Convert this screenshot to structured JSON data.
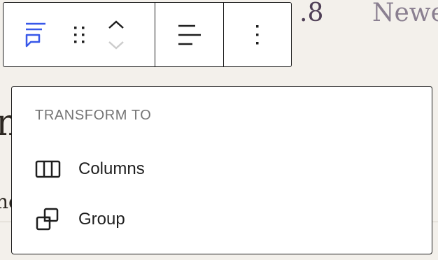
{
  "background": {
    "heading_fragment": ".8",
    "nav_fragment": "Newe",
    "title_fragment": "n",
    "body_fragment": "ne"
  },
  "toolbar": {
    "block_icon": "quote-block-icon",
    "drag_icon": "drag-handle-icon",
    "move_up_icon": "chevron-up-icon",
    "move_down_icon": "chevron-down-icon",
    "align_icon": "align-left-icon",
    "options_icon": "more-vertical-icon",
    "accent_color": "#3858e9"
  },
  "transform_menu": {
    "heading": "TRANSFORM TO",
    "items": [
      {
        "label": "Columns",
        "icon": "columns-icon"
      },
      {
        "label": "Group",
        "icon": "group-icon"
      }
    ]
  }
}
